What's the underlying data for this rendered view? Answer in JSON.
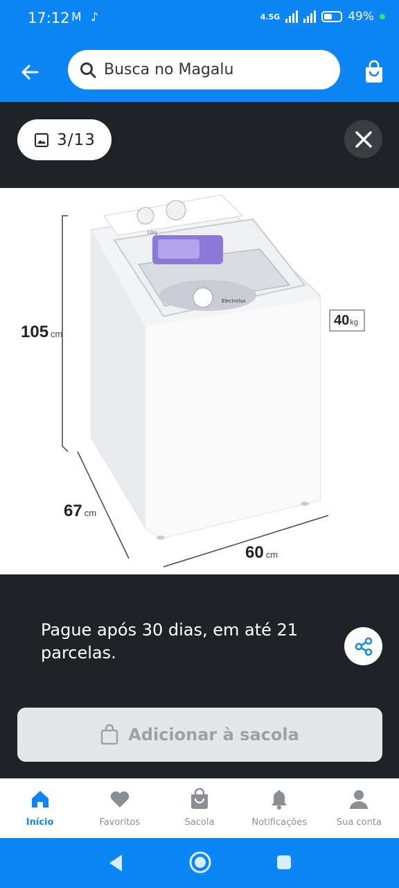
{
  "status": {
    "time": "17:12",
    "left_icons": "M ♪",
    "network": "4.5G",
    "battery": "49%"
  },
  "header": {
    "search_placeholder": "Busca no Magalu"
  },
  "gallery": {
    "counter": "3/13"
  },
  "product_image": {
    "dimensions": {
      "height_value": "105",
      "height_unit": "cm",
      "depth_value": "67",
      "depth_unit": "cm",
      "width_value": "60",
      "width_unit": "cm",
      "weight_value": "40",
      "weight_unit": "kg"
    },
    "machine_labels": {
      "capacity": "12kg",
      "brand": "Electrolux"
    }
  },
  "installments_text": "Pague após 30 dias, em até 21 parcelas.",
  "add_to_cart_label": "Adicionar à sacola",
  "bottom_nav": [
    {
      "label": "Início",
      "icon": "home-icon",
      "active": true
    },
    {
      "label": "Favoritos",
      "icon": "heart-icon",
      "active": false
    },
    {
      "label": "Sacola",
      "icon": "bag-icon",
      "active": false
    },
    {
      "label": "Notificações",
      "icon": "bell-icon",
      "active": false
    },
    {
      "label": "Sua conta",
      "icon": "user-icon",
      "active": false
    }
  ],
  "colors": {
    "brand_blue": "#0d86f5",
    "dark_bg": "#1f2327",
    "disabled_button": "#e4e7ea"
  }
}
